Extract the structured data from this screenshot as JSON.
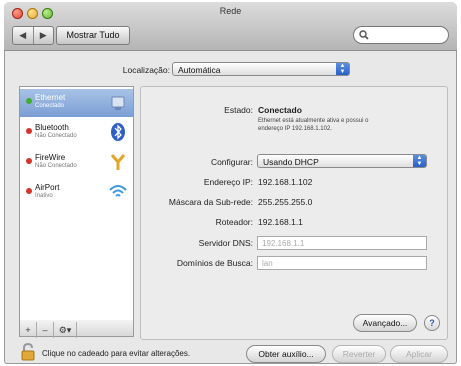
{
  "window": {
    "title": "Rede"
  },
  "toolbar": {
    "back_forward": [
      "◀",
      "▶"
    ],
    "show_all": "Mostrar Tudo",
    "search_icon": "search-icon"
  },
  "location": {
    "label": "Localização:",
    "value": "Automática"
  },
  "services": [
    {
      "name": "Ethernet",
      "status": "Conectado",
      "status_color": "#3fae2e",
      "selected": true,
      "icon": "ethernet-icon"
    },
    {
      "name": "Bluetooth",
      "status": "Não Conectado",
      "status_color": "#d8322a",
      "selected": false,
      "icon": "bluetooth-icon"
    },
    {
      "name": "FireWire",
      "status": "Não Conectado",
      "status_color": "#d8322a",
      "selected": false,
      "icon": "firewire-icon"
    },
    {
      "name": "AirPort",
      "status": "Inativo",
      "status_color": "#d8322a",
      "selected": false,
      "icon": "airport-wifi-icon"
    }
  ],
  "sidebar_controls": [
    "+",
    "–",
    "⚙▾"
  ],
  "details": {
    "state_label": "Estado:",
    "state_value": "Conectado",
    "state_desc_line1": "Ethernet está atualmente ativa e possui o",
    "state_desc_line2": "endereço IP 192.168.1.102.",
    "configure_label": "Configurar:",
    "configure_value": "Usando DHCP",
    "ip_label": "Endereço IP:",
    "ip_value": "192.168.1.102",
    "subnet_label": "Máscara da Sub-rede:",
    "subnet_value": "255.255.255.0",
    "router_label": "Roteador:",
    "router_value": "192.168.1.1",
    "dns_label": "Servidor DNS:",
    "dns_value": "192.168.1.1",
    "domains_label": "Domínios de Busca:",
    "domains_value": "lan",
    "advanced_button": "Avançado...",
    "help_button": "?"
  },
  "footer": {
    "lock_text": "Clique no cadeado para evitar alterações.",
    "assist_button": "Obter auxílio...",
    "revert_button": "Reverter",
    "apply_button": "Aplicar"
  },
  "colors": {
    "accent": "#2f6fd6",
    "selection": "#8aabdc"
  }
}
